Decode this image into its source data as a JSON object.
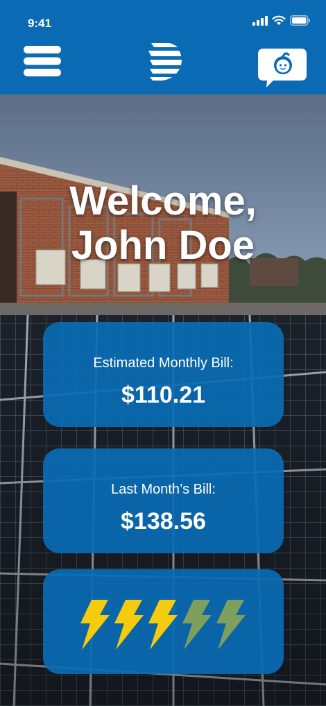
{
  "status_bar": {
    "time": "9:41"
  },
  "header": {
    "menu_icon": "hamburger-menu-icon",
    "logo_icon": "striped-sphere-logo",
    "chat_icon": "chat-bubble-baby-icon"
  },
  "welcome": {
    "line1": "Welcome,",
    "line2": "John Doe"
  },
  "cards": {
    "estimated": {
      "label": "Estimated Monthly Bill:",
      "value": "$110.21"
    },
    "last_month": {
      "label": "Last Month’s Bill:",
      "value": "$138.56"
    },
    "energy_rating": {
      "filled": 3,
      "total": 5
    }
  },
  "colors": {
    "brand_blue": "#0a6bb4",
    "bolt_active": "#f5cc0d",
    "bolt_inactive": "#7f9f5e"
  }
}
